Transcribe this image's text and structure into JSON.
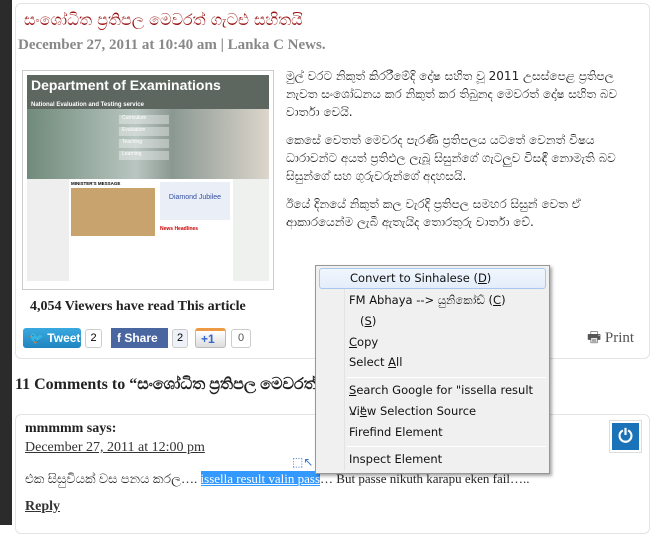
{
  "article": {
    "title": "සංශෝධිත ප්‍රතිපල මෙවරත් ගැටළු සහිතයි",
    "meta": "December 27, 2011 at 10:40 am | Lanka C News.",
    "image": {
      "header": "Department of Examinations",
      "subheader": "National Evaluation and Testing service",
      "nav": [
        "Curriculum",
        "Evaluation",
        "Teaching",
        "Learning"
      ],
      "minister": "MINISTER'S MESSAGE",
      "jubilee": "Diamond Jubilee",
      "news": "News Headlines"
    },
    "paragraphs": [
      "මුල් වරට නිකුත් කිරරීමේදි දෝෂ සහිත වූ 2011 උසස්පෙළ ප්‍රතිපල නැවත සංශෝධනය කර නිකුත් කර තිබුනද මෙවරත් දෝෂ සහිත බව වාර්තා වෙයි.",
      "කෙසේ වෙතත් මෙවරද පැරණි ප්‍රතිපලය යටතේ වෙනත් විෂය ධාරාවන්ට අයත් ප්‍රතිඵල ලැබූ සිසුන්ගේ ගැටලුව විසඳී නොමැති බව සිසුන්ගේ සහ ගුරුවරුන්ගේ අදහසයි.",
      "ඊයේ දිනයේ නිකුත් කල වැරදි ප්‍රතිපල සමහර සිසුන් වෙත ඒ ආකාරයෙන්ම ලැබී ඇතැයිද තොරතුරු වාර්තා වේ."
    ],
    "viewers": "4,054 Viewers have read This article",
    "share": {
      "tweet": "Tweet",
      "tweet_count": "2",
      "facebook": "Share",
      "facebook_count": "2",
      "gplus": "+1",
      "gplus_count": "0"
    },
    "print": "Print"
  },
  "comments": {
    "heading": "11 Comments to “සංශෝධිත ප්‍රතිපල මෙවරත්",
    "items": [
      {
        "author": "mmmmm says:",
        "date": "December 27, 2011 at 12:00 pm",
        "text_before": "එක සිසුවියක් වස පනය කරල…. ",
        "text_selected": "issella result valin pass",
        "text_after": "… But passe nikuth karapu eken fail…..",
        "reply": "Reply"
      }
    ]
  },
  "context_menu": {
    "items": [
      {
        "label": "Convert to Sinhalese (",
        "key": "D",
        "tail": ")"
      },
      {
        "label": "FM Abhaya --> යුනිකෝඩ් (",
        "key": "C",
        "tail": ")"
      },
      {
        "label": "(",
        "key": "S",
        "tail": ")"
      },
      {
        "label": "",
        "key": "C",
        "tail": "opy"
      },
      {
        "label": "Select ",
        "key": "A",
        "tail": "ll"
      },
      {
        "label": "",
        "key": "S",
        "tail": "earch Google for \"issella result ...\""
      },
      {
        "label": "Vi",
        "key": "e",
        "tail": "w Selection Source"
      },
      {
        "label": "Firefind Element",
        "key": "",
        "tail": ""
      },
      {
        "label": "Inspect Element",
        "key": "",
        "tail": ""
      }
    ]
  },
  "colors": {
    "title": "#9b1111",
    "selection": "#3399ff",
    "twitter": "#2a9ad6",
    "facebook": "#4a66a0"
  }
}
